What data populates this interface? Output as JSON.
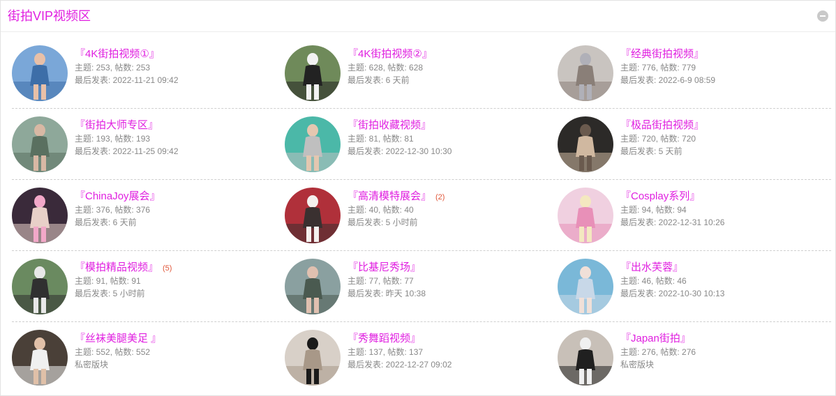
{
  "panel": {
    "title": "街拍VIP视频区"
  },
  "colors": {
    "accent": "#e020e0",
    "new_count": "#e0573a",
    "meta": "#888888"
  },
  "forums": [
    {
      "name": "『4K街拍视频①』",
      "stats": "主题: 253, 帖数: 253",
      "last": "最后发表: 2022-11-21 09:42",
      "new": "",
      "palette": [
        "#7aa7d8",
        "#e8c0a8",
        "#3d6ea8"
      ]
    },
    {
      "name": "『4K街拍视频②』",
      "stats": "主题: 628, 帖数: 628",
      "last": "最后发表: 6 天前",
      "new": "",
      "palette": [
        "#6f8a5a",
        "#f2f2f2",
        "#222222"
      ]
    },
    {
      "name": "『经典街拍视频』",
      "stats": "主题: 776, 帖数: 779",
      "last": "最后发表: 2022-6-9 08:59",
      "new": "",
      "palette": [
        "#c9c4c0",
        "#b0b0b8",
        "#8a7f78"
      ]
    },
    {
      "name": "『街拍大师专区』",
      "stats": "主题: 193, 帖数: 193",
      "last": "最后发表: 2022-11-25 09:42",
      "new": "",
      "palette": [
        "#8ea89a",
        "#d8b8a4",
        "#5a7060"
      ]
    },
    {
      "name": "『街拍收藏视频』",
      "stats": "主题: 81, 帖数: 81",
      "last": "最后发表: 2022-12-30 10:30",
      "new": "",
      "palette": [
        "#4bb8a8",
        "#e4c7b0",
        "#bfbfbf"
      ]
    },
    {
      "name": "『极品街拍视频』",
      "stats": "主题: 720, 帖数: 720",
      "last": "最后发表: 5 天前",
      "new": "",
      "palette": [
        "#2c2a28",
        "#6a5a4e",
        "#d0b8a0"
      ]
    },
    {
      "name": "『ChinaJoy展会』",
      "stats": "主题: 376, 帖数: 376",
      "last": "最后发表: 6 天前",
      "new": "",
      "palette": [
        "#3a2a3a",
        "#f2a8c8",
        "#e8d0c8"
      ]
    },
    {
      "name": "『高清模特展会』",
      "stats": "主题: 40, 帖数: 40",
      "last": "最后发表: 5 小时前",
      "new": "(2)",
      "palette": [
        "#b0303a",
        "#f4f0ee",
        "#3a3030"
      ]
    },
    {
      "name": "『Cosplay系列』",
      "stats": "主题: 94, 帖数: 94",
      "last": "最后发表: 2022-12-31 10:26",
      "new": "",
      "palette": [
        "#f0d0e0",
        "#f4e8c0",
        "#e890b8"
      ]
    },
    {
      "name": "『模拍精品视频』",
      "stats": "主题: 91, 帖数: 91",
      "last": "最后发表: 5 小时前",
      "new": "(5)",
      "palette": [
        "#6a8a60",
        "#e8e8e8",
        "#303030"
      ]
    },
    {
      "name": "『比基尼秀场』",
      "stats": "主题: 77, 帖数: 77",
      "last": "最后发表: 昨天 10:38",
      "new": "",
      "palette": [
        "#8aa0a0",
        "#e0c0b0",
        "#4a5a50"
      ]
    },
    {
      "name": "『出水芙蓉』",
      "stats": "主题: 46, 帖数: 46",
      "last": "最后发表: 2022-10-30 10:13",
      "new": "",
      "palette": [
        "#7ab8d8",
        "#f0e0d8",
        "#c8d8e8"
      ]
    },
    {
      "name": "『丝袜美腿美足 』",
      "stats": "主题: 552, 帖数: 552",
      "last": "私密版块",
      "new": "",
      "palette": [
        "#4a4038",
        "#e0c0a8",
        "#f0f0f0"
      ]
    },
    {
      "name": "『秀舞蹈视频』",
      "stats": "主题: 137, 帖数: 137",
      "last": "最后发表: 2022-12-27 09:02",
      "new": "",
      "palette": [
        "#d8d0c8",
        "#1a1a1a",
        "#a89888"
      ]
    },
    {
      "name": "『Japan街拍』",
      "stats": "主题: 276, 帖数: 276",
      "last": "私密版块",
      "new": "",
      "palette": [
        "#c8c0b8",
        "#f0f0f0",
        "#202020"
      ]
    }
  ]
}
